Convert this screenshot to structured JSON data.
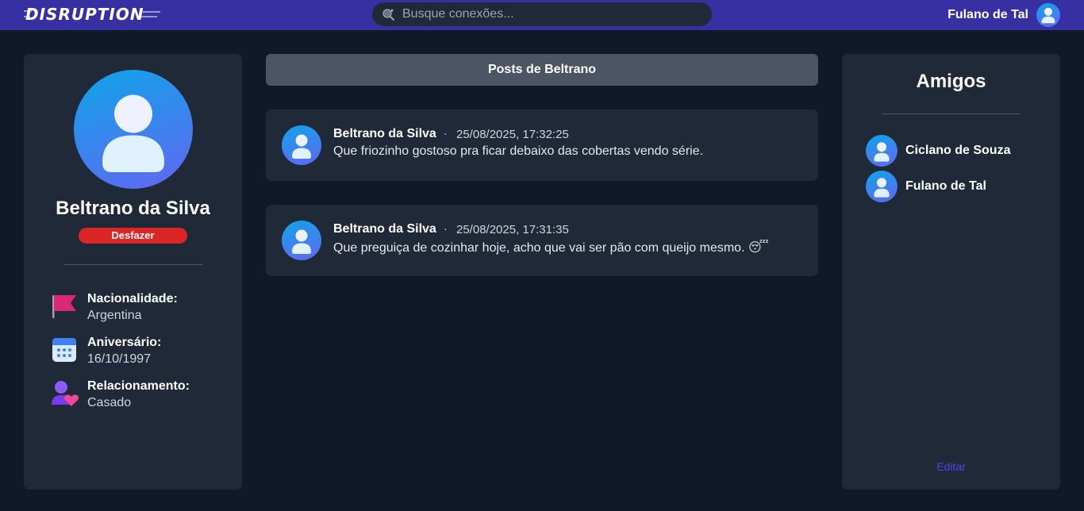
{
  "header": {
    "logo": "DISRUPTION",
    "search_placeholder": "Busque conexões...",
    "user_name": "Fulano de Tal"
  },
  "profile": {
    "name": "Beltrano da Silva",
    "undo_label": "Desfazer",
    "info": [
      {
        "icon": "flag-icon",
        "label": "Nacionalidade:",
        "value": "Argentina"
      },
      {
        "icon": "calendar-icon",
        "label": "Aniversário:",
        "value": "16/10/1997"
      },
      {
        "icon": "relationship-icon",
        "label": "Relacionamento:",
        "value": "Casado"
      }
    ]
  },
  "posts": {
    "header": "Posts de Beltrano",
    "items": [
      {
        "author": "Beltrano da Silva",
        "separator": "·",
        "timestamp": "25/08/2025, 17:32:25",
        "text": "Que friozinho gostoso pra ficar debaixo das cobertas vendo série."
      },
      {
        "author": "Beltrano da Silva",
        "separator": "·",
        "timestamp": "25/08/2025, 17:31:35",
        "text": "Que preguiça de cozinhar hoje, acho que vai ser pão com queijo mesmo. 😴"
      }
    ]
  },
  "friends": {
    "title": "Amigos",
    "items": [
      {
        "name": "Ciclano de Souza"
      },
      {
        "name": "Fulano de Tal"
      }
    ],
    "edit_label": "Editar"
  },
  "colors": {
    "topbar": "#3730a3",
    "background": "#111827",
    "card": "#1f2937",
    "danger": "#dc2626",
    "link": "#4f46e5"
  }
}
